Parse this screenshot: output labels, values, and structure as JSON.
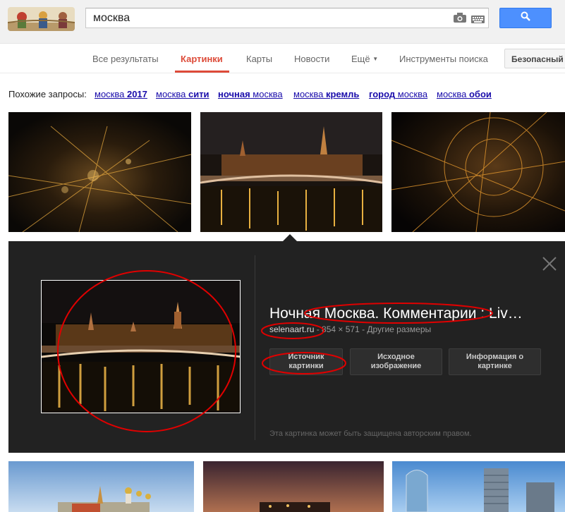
{
  "search": {
    "query": "москва"
  },
  "nav": {
    "all": "Все результаты",
    "images": "Картинки",
    "maps": "Карты",
    "news": "Новости",
    "more": "Ещё",
    "tools": "Инструменты поиска",
    "safe_search": "Безопасный поиск"
  },
  "related": {
    "label": "Похожие запросы:",
    "items": [
      {
        "plain": "москва ",
        "bold": "2017"
      },
      {
        "plain": "москва ",
        "bold": "сити"
      },
      {
        "bold": "ночная",
        "plain": " москва"
      },
      {
        "plain": "москва ",
        "bold": "кремль"
      },
      {
        "bold": "город",
        "plain": " москва"
      },
      {
        "plain": "москва ",
        "bold": "обои"
      }
    ]
  },
  "panel": {
    "title": "Ночная Москва. Комментарии : Liv…",
    "site": "selenaart.ru",
    "dims": " - 854 × 571 - Другие размеры",
    "btn_source_1": "Источник",
    "btn_source_2": "картинки",
    "btn_original_1": "Исходное",
    "btn_original_2": "изображение",
    "btn_info_1": "Информация о",
    "btn_info_2": "картинке",
    "copyright": "Эта картинка может быть защищена авторским правом."
  },
  "colors": {
    "accent": "#dd4b39",
    "link": "#1a0dab",
    "search_button": "#4d90fe",
    "annotation": "#e00000"
  }
}
